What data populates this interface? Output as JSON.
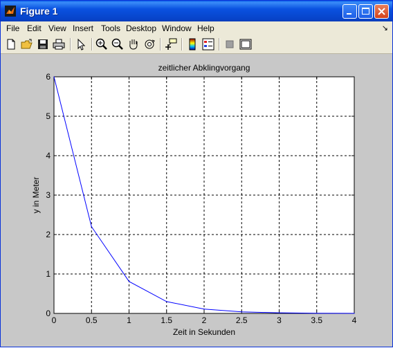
{
  "window": {
    "title": "Figure 1"
  },
  "menu": {
    "items": [
      "File",
      "Edit",
      "View",
      "Insert",
      "Tools",
      "Desktop",
      "Window",
      "Help"
    ],
    "arrow": "↘"
  },
  "toolbar": {
    "icons": [
      "new-file-icon",
      "open-folder-icon",
      "save-icon",
      "print-icon",
      "pointer-icon",
      "zoom-in-icon",
      "zoom-out-icon",
      "pan-hand-icon",
      "rotate-3d-icon",
      "data-cursor-icon",
      "colorbar-icon",
      "legend-icon",
      "hide-plot-tools-icon",
      "show-plot-tools-icon"
    ]
  },
  "colors": {
    "line": "#0000ff",
    "titlebar": "#0a52e0",
    "figure_bg": "#c8c8c8"
  },
  "chart_data": {
    "type": "line",
    "title": "zeitlicher Abklingvorgang",
    "xlabel": "Zeit in Sekunden",
    "ylabel": "y in Meter",
    "xlim": [
      0,
      4
    ],
    "ylim": [
      0,
      6
    ],
    "xticks": [
      "0",
      "0.5",
      "1",
      "1.5",
      "2",
      "2.5",
      "3",
      "3.5",
      "4"
    ],
    "yticks": [
      "0",
      "1",
      "2",
      "3",
      "4",
      "5",
      "6"
    ],
    "grid": true,
    "series": [
      {
        "x": [
          0,
          0.5,
          1,
          1.5,
          2,
          2.5,
          3,
          3.5,
          4
        ],
        "values": [
          6,
          2.2,
          0.81,
          0.3,
          0.11,
          0.04,
          0.015,
          0.005,
          0.002
        ]
      }
    ]
  }
}
